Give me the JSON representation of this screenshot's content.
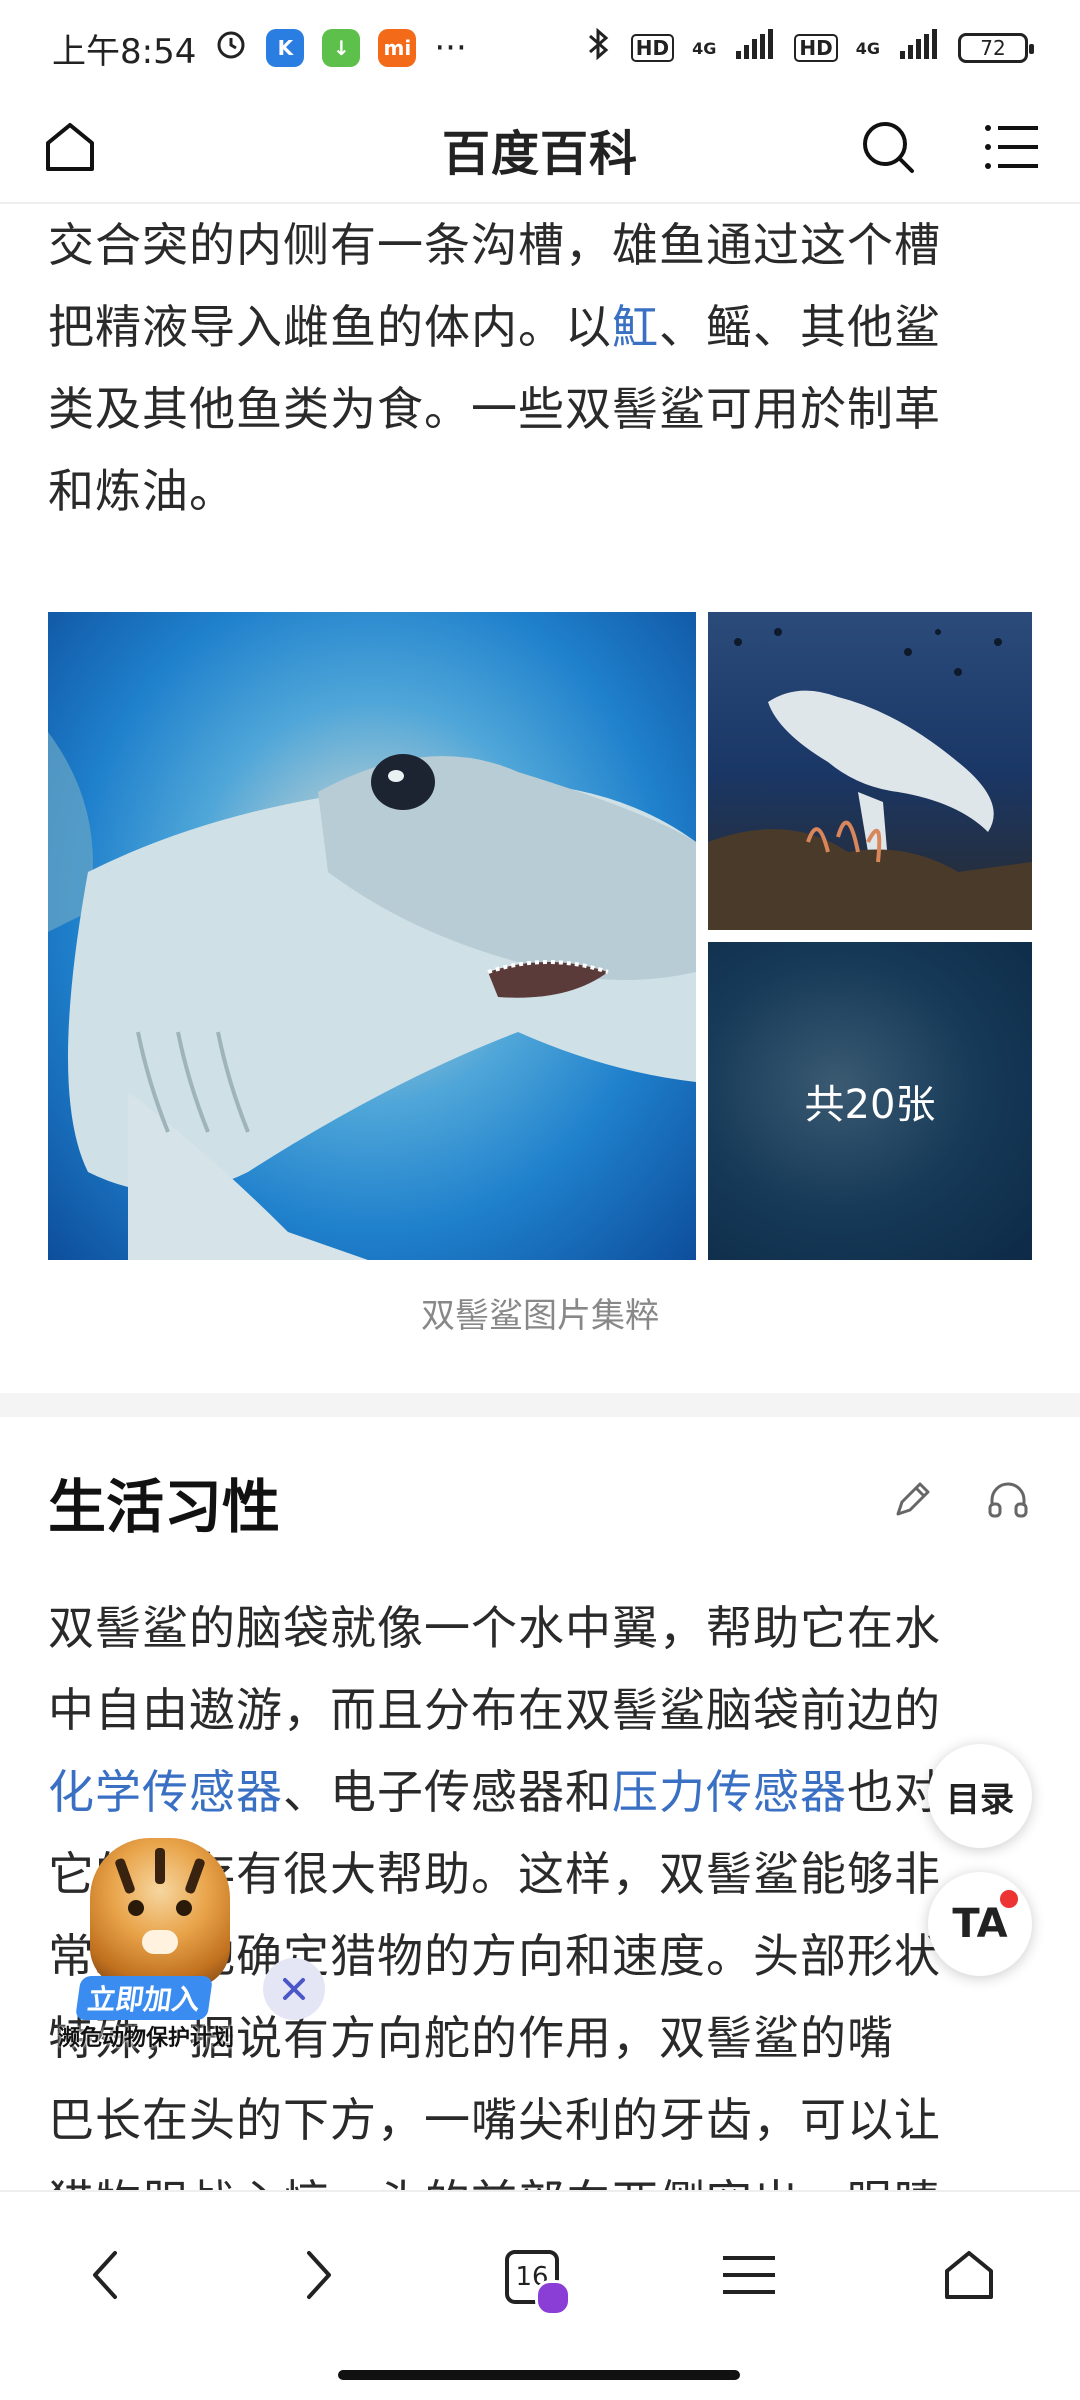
{
  "status_bar": {
    "time": "上午8:54",
    "battery": "72",
    "net1": "HD",
    "net2": "HD",
    "gen1": "4G",
    "gen2": "4G",
    "more": "···"
  },
  "header": {
    "title": "百度百科"
  },
  "intro": {
    "line1": "交合突的内侧有一条沟槽，雄鱼通过这个槽",
    "line2a": "把精液导入雌鱼的体内。以",
    "line2_link": "魟",
    "line2b": "、鳐、其他鲨",
    "line3": "类及其他鱼类为食。一些双髻鲨可用於制革",
    "line4": "和炼油。"
  },
  "gallery": {
    "count_label": "共20张",
    "caption": "双髻鲨图片集粹"
  },
  "section": {
    "title": "生活习性",
    "p_line1": "双髻鲨的脑袋就像一个水中翼，帮助它在水",
    "p_line2": "中自由遨游，而且分布在双髻鲨脑袋前边的",
    "p_line3_link1": "化学传感器",
    "p_line3_mid": "、电子传感器和",
    "p_line3_link2": "压力传感器",
    "p_line3_end": "也对",
    "p_line4": "它的生存有很大帮助。这样，双髻鲨能够非",
    "p_line5": "常准确地确定猎物的方向和速度。头部形状",
    "p_line6": "特殊，据说有方向舵的作用，双髻鲨的嘴",
    "p_line7": "巴长在头的下方，一嘴尖利的牙齿，可以让",
    "p_line8": "猎物胆战心惊，头的前部向两侧突出，眼睛"
  },
  "float": {
    "toc_label": "目录",
    "ta_label": "TA"
  },
  "promo": {
    "join_label": "立即加入",
    "subtitle": "濒危动物保护计划"
  },
  "bottom_bar": {
    "tab_count": "16"
  },
  "colors": {
    "link": "#3a70c4",
    "accent_purple": "#8a3ed6"
  }
}
